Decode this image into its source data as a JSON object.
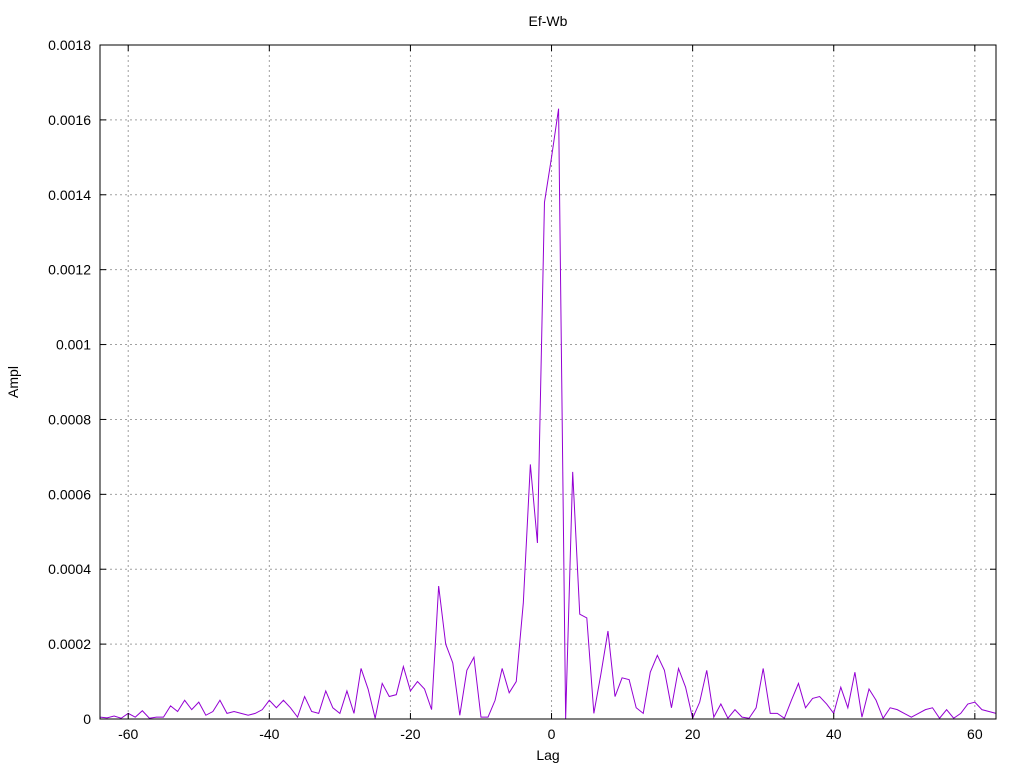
{
  "chart_data": {
    "type": "line",
    "title": "Ef-Wb",
    "xlabel": "Lag",
    "ylabel": "Ampl",
    "xlim": [
      -64,
      63
    ],
    "ylim": [
      0,
      0.0018
    ],
    "x_ticks": [
      -60,
      -40,
      -20,
      0,
      20,
      40,
      60
    ],
    "y_ticks": [
      0,
      0.0002,
      0.0004,
      0.0006,
      0.0008,
      0.001,
      0.0012,
      0.0014,
      0.0016,
      0.0018
    ],
    "x_tick_labels": [
      "-60",
      "-40",
      "-20",
      "0",
      "20",
      "40",
      "60"
    ],
    "y_tick_labels": [
      "0",
      "0.0002",
      "0.0004",
      "0.0006",
      "0.0008",
      "0.001",
      "0.0012",
      "0.0014",
      "0.0016",
      "0.0018"
    ],
    "grid": true,
    "line_color": "#9400d3",
    "series": [
      {
        "x": [
          -64,
          -63,
          -62,
          -61,
          -60,
          -59,
          -58,
          -57,
          -56,
          -55,
          -54,
          -53,
          -52,
          -51,
          -50,
          -49,
          -48,
          -47,
          -46,
          -45,
          -44,
          -43,
          -42,
          -41,
          -40,
          -39,
          -38,
          -37,
          -36,
          -35,
          -34,
          -33,
          -32,
          -31,
          -30,
          -29,
          -28,
          -27,
          -26,
          -25,
          -24,
          -23,
          -22,
          -21,
          -20,
          -19,
          -18,
          -17,
          -16,
          -15,
          -14,
          -13,
          -12,
          -11,
          -10,
          -9,
          -8,
          -7,
          -6,
          -5,
          -4,
          -3,
          -2,
          -1,
          0,
          1,
          2,
          3,
          4,
          5,
          6,
          7,
          8,
          9,
          10,
          11,
          12,
          13,
          14,
          15,
          16,
          17,
          18,
          19,
          20,
          21,
          22,
          23,
          24,
          25,
          26,
          27,
          28,
          29,
          30,
          31,
          32,
          33,
          34,
          35,
          36,
          37,
          38,
          39,
          40,
          41,
          42,
          43,
          44,
          45,
          46,
          47,
          48,
          49,
          50,
          51,
          52,
          53,
          54,
          55,
          56,
          57,
          58,
          59,
          60,
          61,
          62,
          63
        ],
        "y": [
          5e-06,
          3e-06,
          8e-06,
          2e-06,
          1.5e-05,
          5e-06,
          2.2e-05,
          2e-06,
          5e-06,
          5e-06,
          3.5e-05,
          2e-05,
          5e-05,
          2.5e-05,
          4.5e-05,
          1e-05,
          2e-05,
          5e-05,
          1.5e-05,
          2e-05,
          1.5e-05,
          1e-05,
          1.5e-05,
          2.5e-05,
          5e-05,
          3e-05,
          5e-05,
          3e-05,
          5e-06,
          6e-05,
          2e-05,
          1.5e-05,
          7.5e-05,
          3e-05,
          1.5e-05,
          7.5e-05,
          1.5e-05,
          0.000135,
          8e-05,
          2e-06,
          9.5e-05,
          6e-05,
          6.5e-05,
          0.00014,
          7.5e-05,
          0.0001,
          8e-05,
          2.5e-05,
          0.000355,
          0.0002,
          0.00015,
          1e-05,
          0.00013,
          0.000165,
          5e-06,
          5e-06,
          5e-05,
          0.000135,
          7e-05,
          0.0001,
          0.00031,
          0.00068,
          0.00047,
          0.00138,
          0.0015,
          0.00163,
          0.0,
          0.00066,
          0.00028,
          0.00027,
          1.5e-05,
          0.00012,
          0.000235,
          6e-05,
          0.00011,
          0.000105,
          3e-05,
          1.5e-05,
          0.000125,
          0.00017,
          0.00013,
          3e-05,
          0.000135,
          8.5e-05,
          2e-06,
          4.5e-05,
          0.00013,
          5e-06,
          4e-05,
          2e-06,
          2.5e-05,
          5e-06,
          2e-06,
          3e-05,
          0.000135,
          1.5e-05,
          1.5e-05,
          2e-06,
          5e-05,
          9.5e-05,
          3e-05,
          5.5e-05,
          6e-05,
          4e-05,
          1.5e-05,
          8.5e-05,
          3e-05,
          0.000125,
          5e-06,
          8e-05,
          5e-05,
          2e-06,
          3e-05,
          2.5e-05,
          1.5e-05,
          5e-06,
          1.5e-05,
          2.5e-05,
          3e-05,
          2e-06,
          2.5e-05,
          2e-06,
          1.5e-05,
          4e-05,
          4.5e-05,
          2.5e-05,
          2e-05,
          1.5e-05
        ]
      }
    ]
  }
}
